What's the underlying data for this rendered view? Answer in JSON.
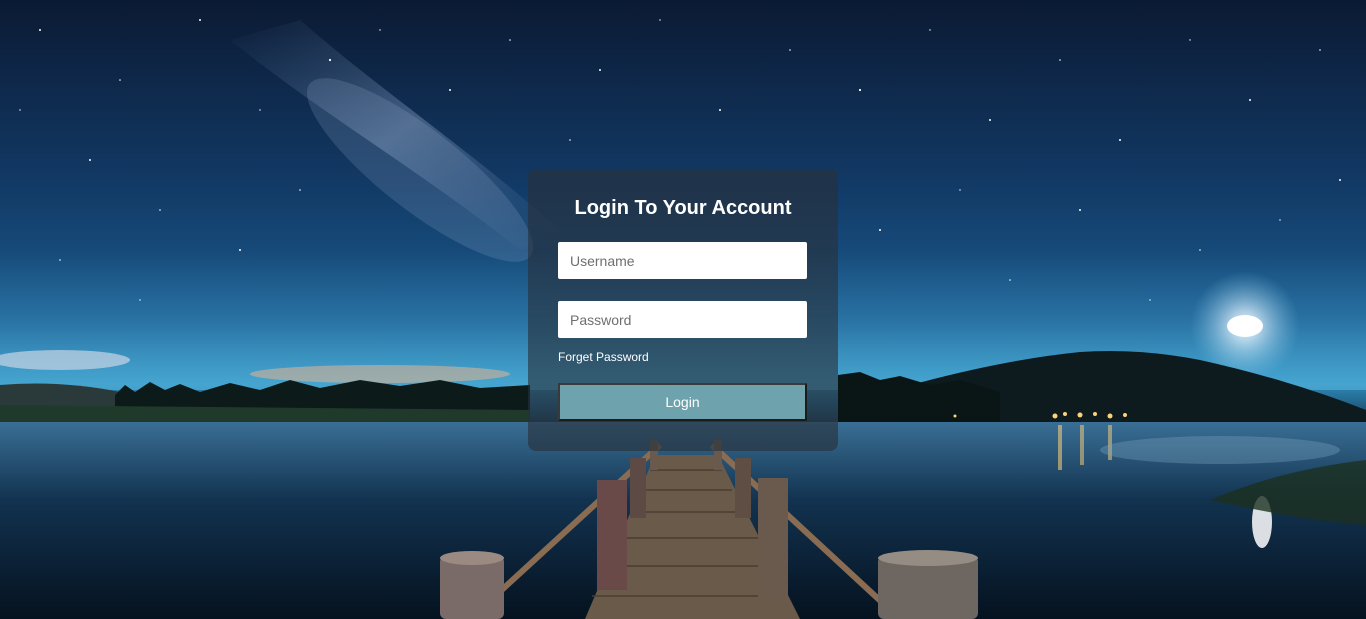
{
  "login": {
    "title": "Login To Your Account",
    "username_placeholder": "Username",
    "password_placeholder": "Password",
    "forget_password_label": "Forget Password",
    "login_button_label": "Login"
  },
  "colors": {
    "button_bg": "#6ea3ad",
    "card_bg": "rgba(40,48,58,0.62)",
    "text": "#ffffff"
  }
}
